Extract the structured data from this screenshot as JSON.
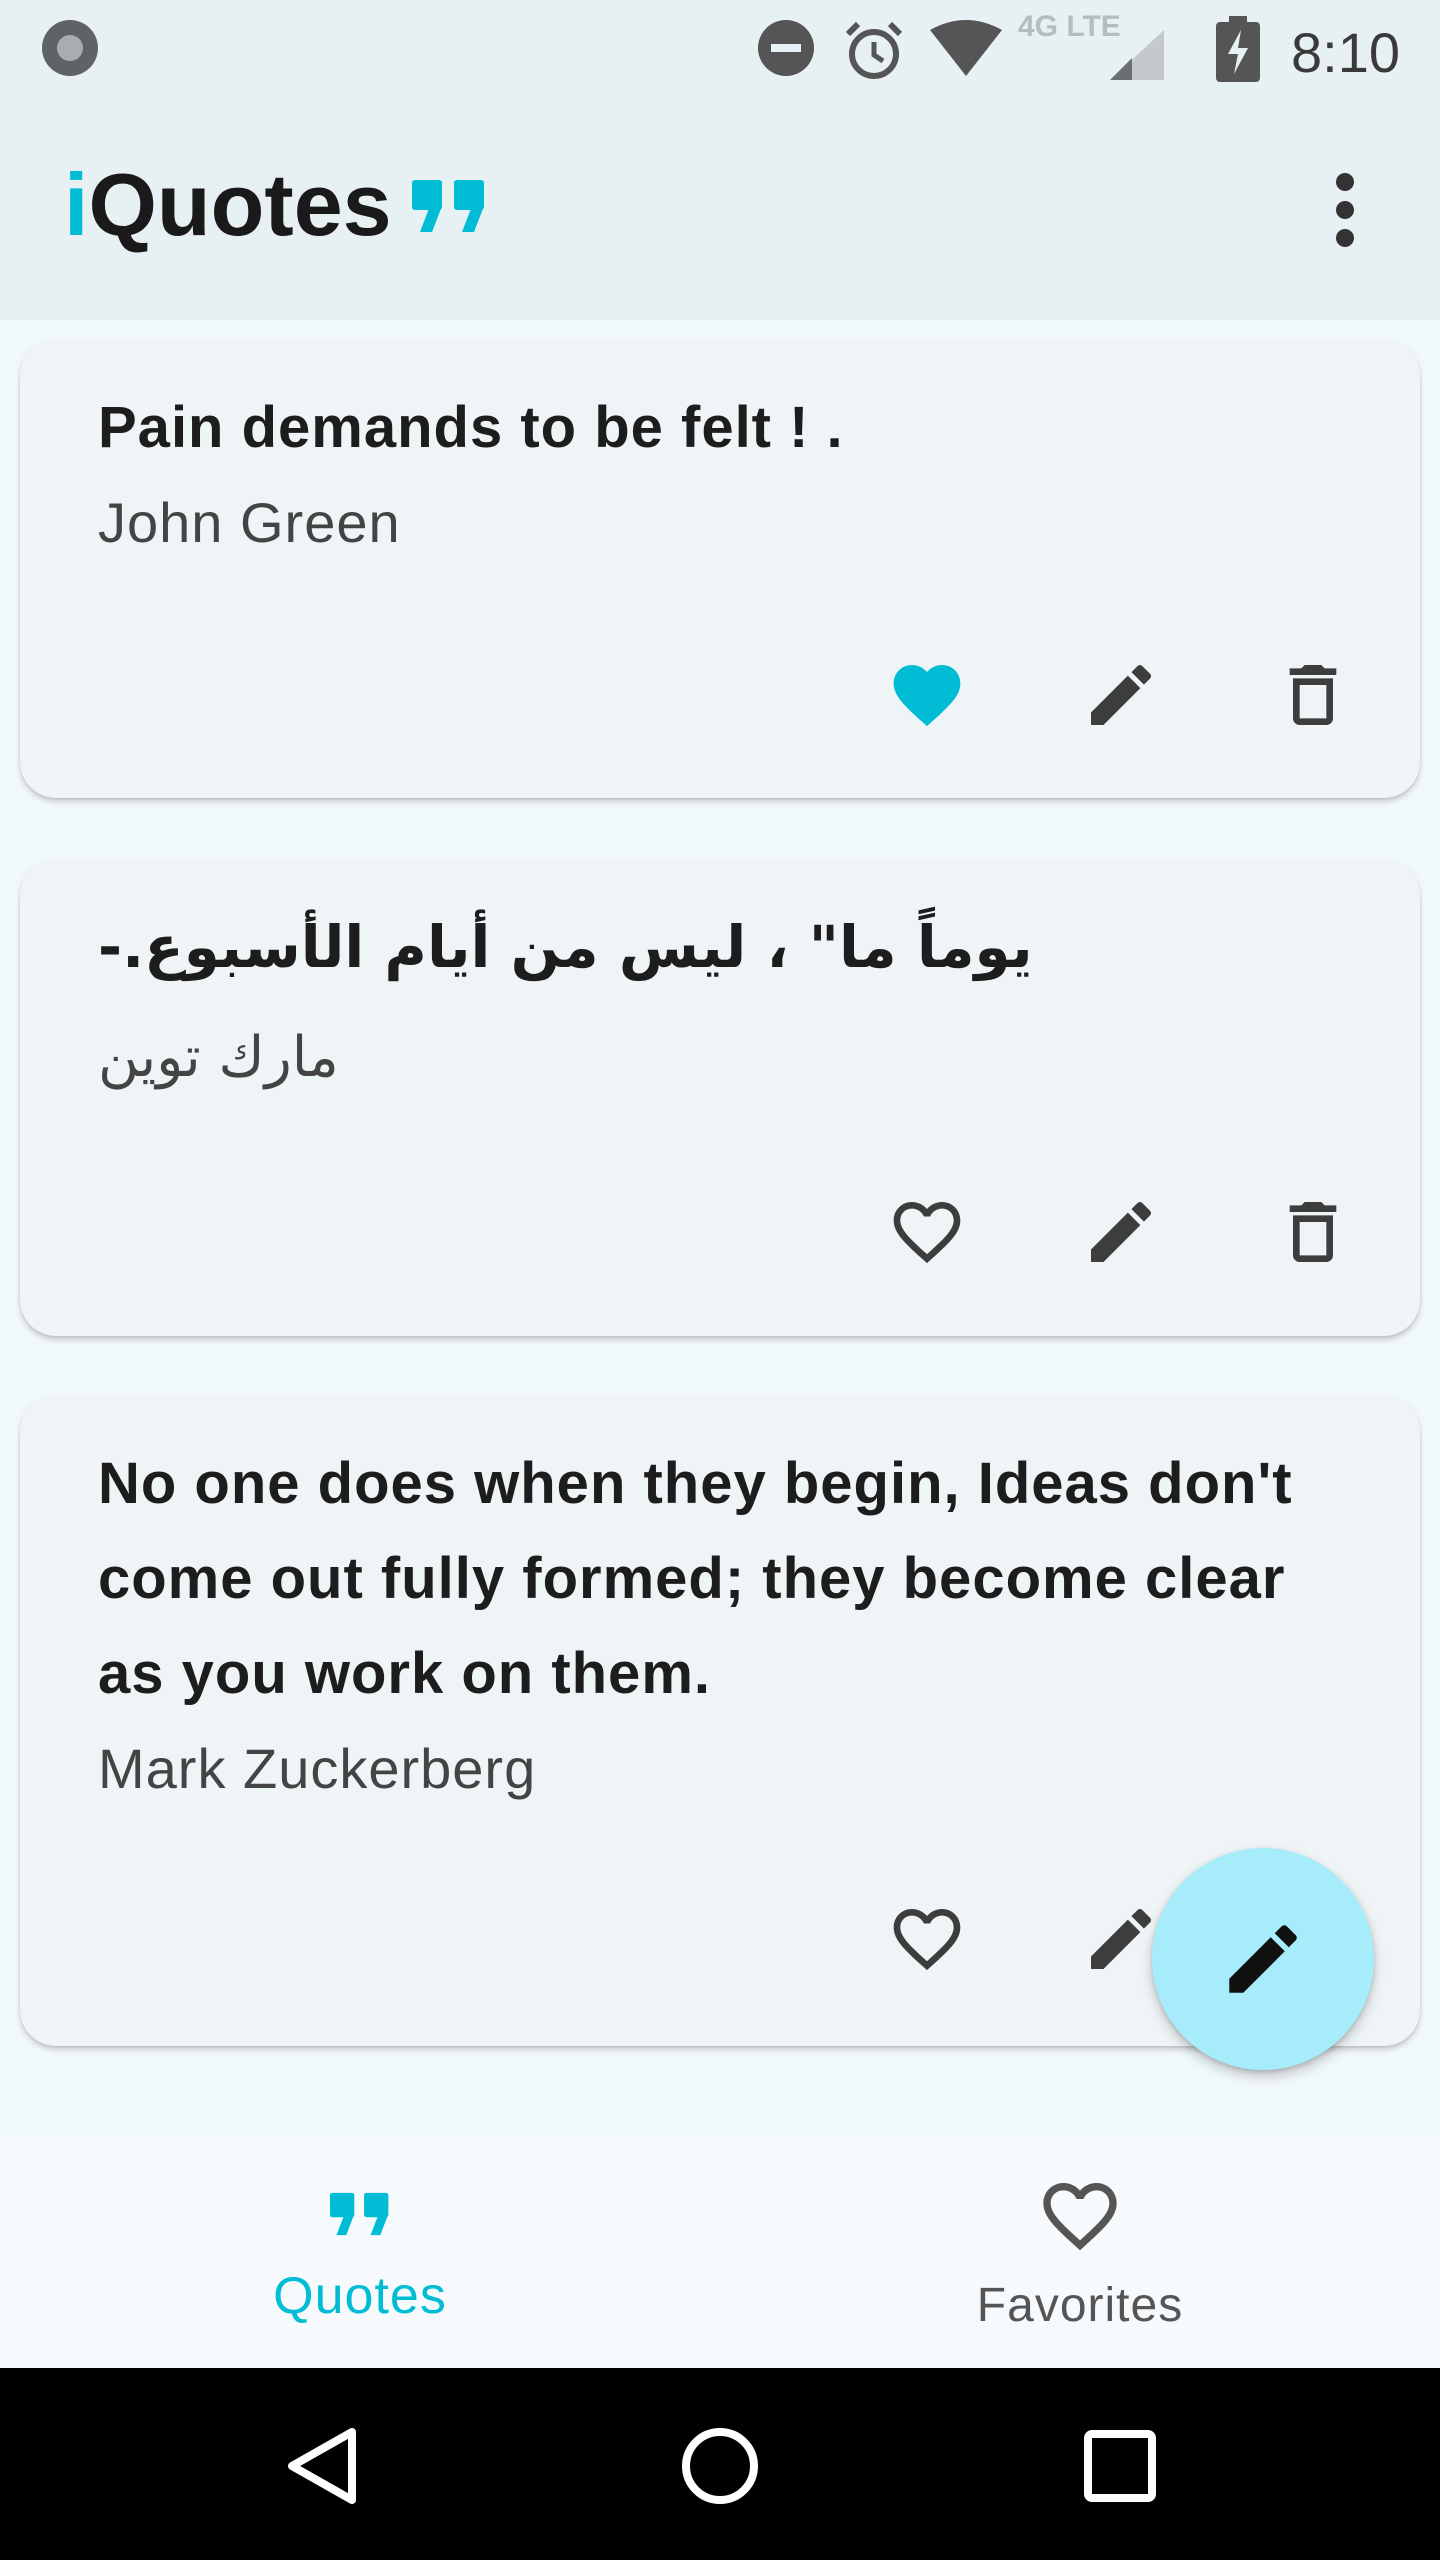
{
  "status_bar": {
    "time": "8:10",
    "network": "4G LTE",
    "icons": [
      "notification-dot-icon",
      "do-not-disturb-icon",
      "alarm-icon",
      "wifi-icon",
      "signal-icon",
      "battery-charging-icon"
    ]
  },
  "app_bar": {
    "title_accent": "i",
    "title_rest": "Quotes",
    "logo_icon": "quote-marks-icon",
    "menu_icon": "more-vert-icon"
  },
  "quotes": [
    {
      "text": "Pain demands to be felt ! .",
      "author": "John Green",
      "favorite": true
    },
    {
      "text": "يوماً ما\" ، ليس من أيام الأسبوع.-",
      "author": "مارك توين",
      "favorite": false
    },
    {
      "text": "No one does when they begin, Ideas don't come out fully formed; they become clear as you work on them.",
      "author": "Mark Zuckerberg",
      "favorite": false
    }
  ],
  "fab": {
    "icon": "pencil-icon"
  },
  "bottom_nav": {
    "items": [
      {
        "label": "Quotes",
        "icon": "quote-marks-icon",
        "active": true
      },
      {
        "label": "Favorites",
        "icon": "heart-outline-icon",
        "active": false
      }
    ]
  },
  "colors": {
    "accent": "#00bcd4",
    "fab": "#a7ecfb",
    "icon": "#3d3d3d"
  }
}
